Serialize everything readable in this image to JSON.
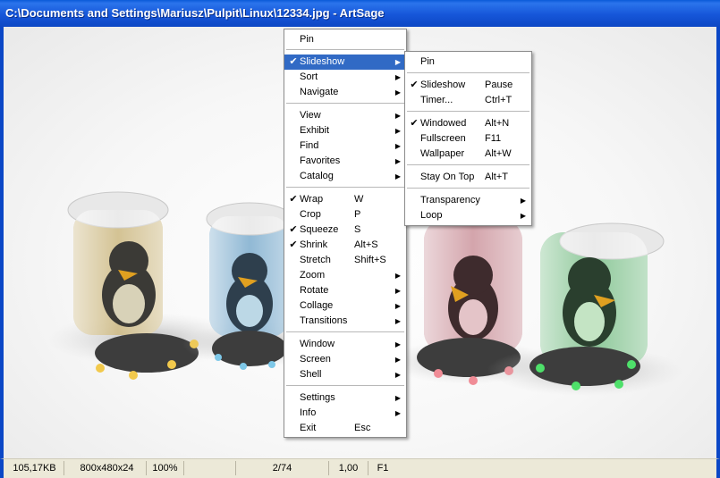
{
  "window": {
    "title": "C:\\Documents and Settings\\Mariusz\\Pulpit\\Linux\\12334.jpg - ArtSage"
  },
  "status": {
    "size": "105,17KB",
    "dimensions": "800x480x24",
    "zoom": "100%",
    "index": "2/74",
    "ratio": "1,00",
    "key": "F1"
  },
  "colors": {
    "title_blue": "#1656d9",
    "highlight": "#316ac5"
  },
  "main_menu": {
    "items": [
      {
        "label": "Pin"
      },
      {
        "label": "Slideshow",
        "checked": true,
        "submenu": true,
        "highlighted": true
      },
      {
        "label": "Sort",
        "submenu": true
      },
      {
        "label": "Navigate",
        "submenu": true
      },
      {
        "label": "View",
        "submenu": true
      },
      {
        "label": "Exhibit",
        "submenu": true
      },
      {
        "label": "Find",
        "submenu": true
      },
      {
        "label": "Favorites",
        "submenu": true
      },
      {
        "label": "Catalog",
        "submenu": true
      },
      {
        "label": "Wrap",
        "checked": true,
        "shortcut": "W"
      },
      {
        "label": "Crop",
        "shortcut": "P"
      },
      {
        "label": "Squeeze",
        "checked": true,
        "shortcut": "S"
      },
      {
        "label": "Shrink",
        "checked": true,
        "shortcut": "Alt+S"
      },
      {
        "label": "Stretch",
        "shortcut": "Shift+S"
      },
      {
        "label": "Zoom",
        "submenu": true
      },
      {
        "label": "Rotate",
        "submenu": true
      },
      {
        "label": "Collage",
        "submenu": true
      },
      {
        "label": "Transitions",
        "submenu": true
      },
      {
        "label": "Window",
        "submenu": true
      },
      {
        "label": "Screen",
        "submenu": true
      },
      {
        "label": "Shell",
        "submenu": true
      },
      {
        "label": "Settings",
        "submenu": true
      },
      {
        "label": "Info",
        "submenu": true
      },
      {
        "label": "Exit",
        "shortcut": "Esc"
      }
    ]
  },
  "sub_menu": {
    "items": [
      {
        "label": "Pin"
      },
      {
        "label": "Slideshow",
        "checked": true,
        "shortcut": "Pause"
      },
      {
        "label": "Timer...",
        "shortcut": "Ctrl+T"
      },
      {
        "label": "Windowed",
        "checked": true,
        "shortcut": "Alt+N"
      },
      {
        "label": "Fullscreen",
        "shortcut": "F11"
      },
      {
        "label": "Wallpaper",
        "shortcut": "Alt+W"
      },
      {
        "label": "Stay On Top",
        "shortcut": "Alt+T"
      },
      {
        "label": "Transparency",
        "submenu": true
      },
      {
        "label": "Loop",
        "submenu": true
      }
    ]
  },
  "icons": {
    "check": "check-icon",
    "submenu_arrow": "submenu-arrow-icon"
  }
}
